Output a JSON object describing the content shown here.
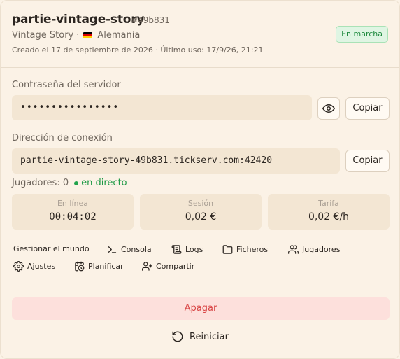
{
  "server": {
    "name": "partie-vintage-story",
    "id_tag": "#49b831",
    "game": "Vintage Story",
    "separator": "·",
    "country": "Alemania",
    "flag_colors": [
      "#000000",
      "#dd0000",
      "#ffce00"
    ],
    "meta": "Creado el 17 de septiembre de 2026 · Último uso: 17/9/26, 21:21",
    "status": "En marcha"
  },
  "password": {
    "label": "Contraseña del servidor",
    "value": "••••••••••••••••",
    "reveal_icon": "eye-icon",
    "copy_label": "Copiar"
  },
  "address": {
    "label": "Dirección de conexión",
    "value": "partie-vintage-story-49b831.tickserv.com:42420",
    "copy_label": "Copiar"
  },
  "players": {
    "label": "Jugadores: 0",
    "live": "en directo"
  },
  "stats": [
    {
      "label": "En línea",
      "value": "00:04:02"
    },
    {
      "label": "Sesión",
      "value": "0,02 €"
    },
    {
      "label": "Tarifa",
      "value": "0,02 €/h"
    }
  ],
  "actions": {
    "manage_world": "Gestionar el mundo",
    "console": "Consola",
    "logs": "Logs",
    "files": "Ficheros",
    "players": "Jugadores",
    "settings": "Ajustes",
    "schedule": "Planificar",
    "share": "Compartir"
  },
  "danger": {
    "stop": "Apagar"
  },
  "restart": {
    "label": "Reiniciar"
  },
  "colors": {
    "accent_green": "#1f9a46",
    "danger_red": "#d94646",
    "surface": "#f3e6d3",
    "background": "#fbf2e6"
  }
}
